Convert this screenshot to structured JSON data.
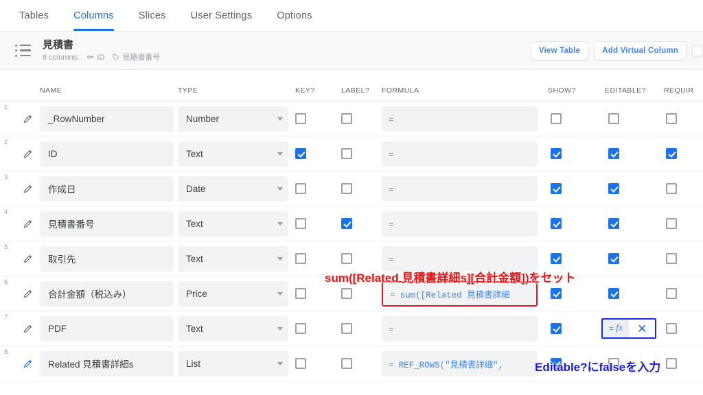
{
  "tabs": [
    {
      "label": "Tables",
      "active": false
    },
    {
      "label": "Columns",
      "active": true
    },
    {
      "label": "Slices",
      "active": false
    },
    {
      "label": "User Settings",
      "active": false
    },
    {
      "label": "Options",
      "active": false
    }
  ],
  "table_card": {
    "name": "見積書",
    "columns_count_label": "8 columns:",
    "key_chip": "ID",
    "label_chip": "見積書番号",
    "buttons": {
      "view_table": "View Table",
      "add_virtual_column": "Add Virtual Column",
      "third_cut": ""
    }
  },
  "headers": {
    "name": "NAME",
    "type": "TYPE",
    "key": "KEY?",
    "label": "LABEL?",
    "formula": "FORMULA",
    "show": "SHOW?",
    "editable": "EDITABLE?",
    "require": "REQUIR"
  },
  "rows": [
    {
      "index": "1",
      "name": "_RowNumber",
      "type": "Number",
      "key": false,
      "label": false,
      "formula": "",
      "show": false,
      "editable": false,
      "require": false,
      "virtual": false
    },
    {
      "index": "2",
      "name": "ID",
      "type": "Text",
      "key": true,
      "label": false,
      "formula": "",
      "show": true,
      "editable": true,
      "require": true,
      "virtual": false
    },
    {
      "index": "3",
      "name": "作成日",
      "type": "Date",
      "key": false,
      "label": false,
      "formula": "",
      "show": true,
      "editable": true,
      "require": false,
      "virtual": false
    },
    {
      "index": "4",
      "name": "見積書番号",
      "type": "Text",
      "key": false,
      "label": true,
      "formula": "",
      "show": true,
      "editable": true,
      "require": false,
      "virtual": false
    },
    {
      "index": "5",
      "name": "取引先",
      "type": "Text",
      "key": false,
      "label": false,
      "formula": "",
      "show": true,
      "editable": true,
      "require": false,
      "virtual": false
    },
    {
      "index": "6",
      "name": "合計金額（税込み）",
      "type": "Price",
      "key": false,
      "label": false,
      "formula": "sum([Related 見積書詳細",
      "show": true,
      "editable": true,
      "require": false,
      "virtual": false
    },
    {
      "index": "7",
      "name": "PDF",
      "type": "Text",
      "key": false,
      "label": false,
      "formula": "",
      "show": true,
      "editable": "fx",
      "require": false,
      "virtual": false
    },
    {
      "index": "8",
      "name": "Related 見積書詳細s",
      "type": "List",
      "key": false,
      "label": false,
      "formula": "REF_ROWS(\"見積書詳細\",",
      "show": true,
      "editable": false,
      "require": false,
      "virtual": true
    }
  ],
  "annotations": {
    "formula_note": "sum([Related 見積書詳細s][合計金額])をセット",
    "editable_note": "Editable?にfalseを入力"
  },
  "colors": {
    "accent": "#1a73e8",
    "annotation_red": "#ee1111",
    "annotation_blue": "#1a1ae0",
    "formula_text": "#4285f4"
  },
  "icons": {
    "list": "list-icon",
    "key": "key-icon",
    "tag": "tag-icon",
    "pencil": "pencil-icon",
    "caret": "chevron-down-icon",
    "fx": "formula-icon",
    "close": "close-icon"
  }
}
